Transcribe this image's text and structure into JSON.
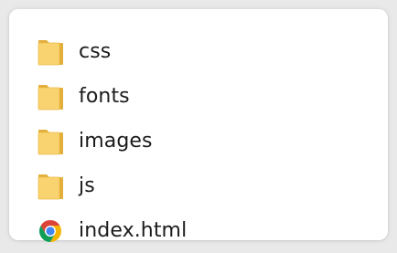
{
  "explorer": {
    "items": [
      {
        "name": "css",
        "type": "folder",
        "icon": "folder-icon"
      },
      {
        "name": "fonts",
        "type": "folder",
        "icon": "folder-icon"
      },
      {
        "name": "images",
        "type": "folder",
        "icon": "folder-icon"
      },
      {
        "name": "js",
        "type": "folder",
        "icon": "folder-icon"
      },
      {
        "name": "index.html",
        "type": "html-file",
        "icon": "chrome-icon"
      }
    ]
  },
  "colors": {
    "folder_front": "#F9D36F",
    "folder_back": "#E3AE3A",
    "chrome_red": "#DB4437",
    "chrome_yellow": "#F4B400",
    "chrome_green": "#0F9D58",
    "chrome_blue": "#4285F4"
  }
}
